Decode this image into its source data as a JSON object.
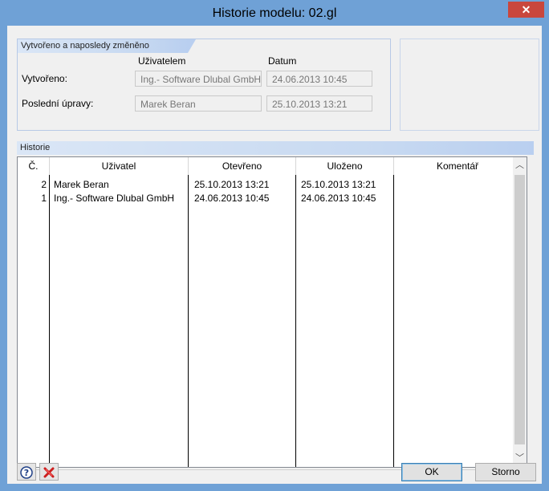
{
  "window": {
    "title": "Historie modelu: 02.gl",
    "close_glyph": "✕"
  },
  "created_group": {
    "header": "Vytvořeno a naposledy změněno",
    "col_user": "Uživatelem",
    "col_date": "Datum",
    "rows": [
      {
        "label": "Vytvořeno:",
        "user": "Ing.- Software Dlubal GmbH",
        "date": "24.06.2013 10:45"
      },
      {
        "label": "Poslední úpravy:",
        "user": "Marek Beran",
        "date": "25.10.2013 13:21"
      }
    ]
  },
  "history": {
    "header": "Historie",
    "columns": [
      "Č.",
      "Uživatel",
      "Otevřeno",
      "Uloženo",
      "Komentář"
    ],
    "rows": [
      {
        "no": "2",
        "user": "Marek Beran",
        "opened": "25.10.2013 13:21",
        "saved": "25.10.2013 13:21",
        "comment": ""
      },
      {
        "no": "1",
        "user": "Ing.- Software Dlubal GmbH",
        "opened": "24.06.2013 10:45",
        "saved": "24.06.2013 10:45",
        "comment": ""
      }
    ]
  },
  "footer": {
    "help_icon": "help-icon",
    "delete_icon": "delete-icon",
    "ok_label": "OK",
    "cancel_label": "Storno"
  }
}
